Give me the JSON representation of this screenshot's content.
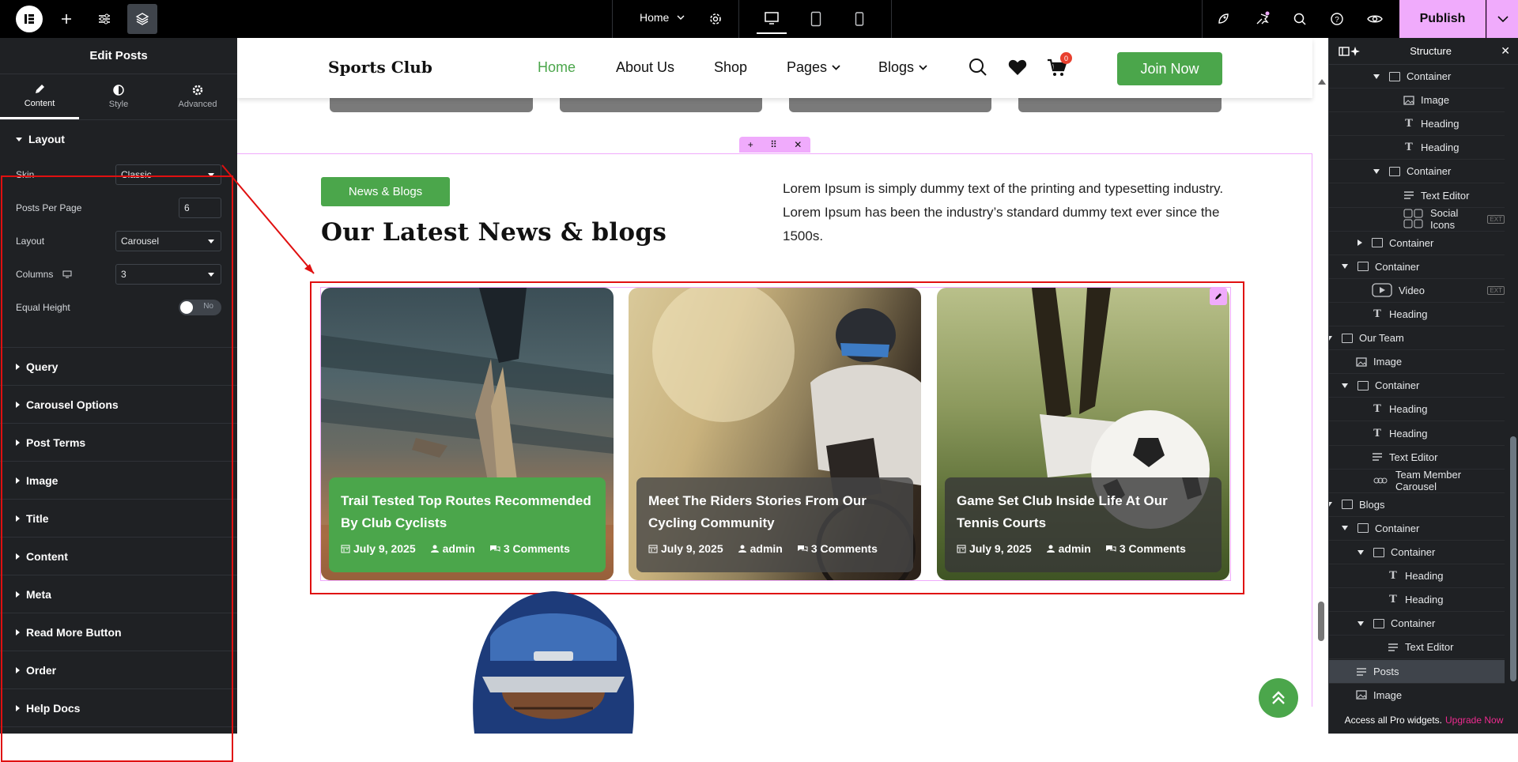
{
  "topbar": {
    "page_name": "Home",
    "publish_label": "Publish"
  },
  "panel": {
    "title": "Edit Posts",
    "tabs": [
      "Content",
      "Style",
      "Advanced"
    ],
    "layout_section": "Layout",
    "controls": {
      "skin_label": "Skin",
      "skin_value": "Classic",
      "ppp_label": "Posts Per Page",
      "ppp_value": "6",
      "layout_label": "Layout",
      "layout_value": "Carousel",
      "columns_label": "Columns",
      "columns_value": "3",
      "equal_label": "Equal Height",
      "equal_value": "No"
    },
    "sections": [
      "Query",
      "Carousel Options",
      "Post Terms",
      "Image",
      "Title",
      "Content",
      "Meta",
      "Read More Button",
      "Order",
      "Help Docs"
    ]
  },
  "site": {
    "brand": "Sports Club",
    "nav": [
      "Home",
      "About Us",
      "Shop",
      "Pages",
      "Blogs"
    ],
    "cart_count": "0",
    "join_label": "Join Now",
    "news_badge": "News & Blogs",
    "news_heading": "Our Latest News & blogs",
    "lorem": "Lorem Ipsum is simply dummy text of the printing and typesetting industry. Lorem Ipsum has been the industry’s standard dummy text ever since the 1500s.",
    "posts": [
      {
        "title": "Trail Tested Top Routes Recommended By Club Cyclists",
        "date": "July 9, 2025",
        "author": "admin",
        "comments": "3 Comments",
        "cover": "#4ba64b"
      },
      {
        "title": "Meet The Riders Stories From Our Cycling Community",
        "date": "July 9, 2025",
        "author": "admin",
        "comments": "3 Comments",
        "cover": "rgba(70,70,70,0.8)"
      },
      {
        "title": "Game Set Club Inside Life At Our Tennis Courts",
        "date": "July 9, 2025",
        "author": "admin",
        "comments": "3 Comments",
        "cover": "rgba(55,55,55,0.8)"
      }
    ]
  },
  "structure": {
    "title": "Structure",
    "nodes": [
      {
        "label": "Container",
        "icon": "container",
        "level": 2,
        "arrow": "down"
      },
      {
        "label": "Image",
        "icon": "image",
        "level": 3
      },
      {
        "label": "Heading",
        "icon": "heading",
        "level": 3
      },
      {
        "label": "Heading",
        "icon": "heading",
        "level": 3
      },
      {
        "label": "Container",
        "icon": "container",
        "level": 2,
        "arrow": "down"
      },
      {
        "label": "Text Editor",
        "icon": "text",
        "level": 3
      },
      {
        "label": "Social Icons",
        "icon": "social",
        "level": 3,
        "ext": true
      },
      {
        "label": "Container",
        "icon": "container",
        "level": 1,
        "arrow": "right"
      },
      {
        "label": "Container",
        "icon": "container",
        "level": 0,
        "arrow": "down"
      },
      {
        "label": "Video",
        "icon": "video",
        "level": 1,
        "ext": true
      },
      {
        "label": "Heading",
        "icon": "heading",
        "level": 1
      },
      {
        "label": "Our Team",
        "icon": "container",
        "level": -1,
        "arrow": "down"
      },
      {
        "label": "Image",
        "icon": "image",
        "level": 0
      },
      {
        "label": "Container",
        "icon": "container",
        "level": 0,
        "arrow": "down"
      },
      {
        "label": "Heading",
        "icon": "heading",
        "level": 1
      },
      {
        "label": "Heading",
        "icon": "heading",
        "level": 1
      },
      {
        "label": "Text Editor",
        "icon": "text",
        "level": 1
      },
      {
        "label": "Team Member Carousel",
        "icon": "carousel",
        "level": 1
      },
      {
        "label": "Blogs",
        "icon": "container",
        "level": -1,
        "arrow": "down"
      },
      {
        "label": "Container",
        "icon": "container",
        "level": 0,
        "arrow": "down"
      },
      {
        "label": "Container",
        "icon": "container",
        "level": 1,
        "arrow": "down"
      },
      {
        "label": "Heading",
        "icon": "heading",
        "level": 2
      },
      {
        "label": "Heading",
        "icon": "heading",
        "level": 2
      },
      {
        "label": "Container",
        "icon": "container",
        "level": 1,
        "arrow": "down"
      },
      {
        "label": "Text Editor",
        "icon": "text",
        "level": 2
      },
      {
        "label": "Posts",
        "icon": "posts",
        "level": 0,
        "selected": true
      },
      {
        "label": "Image",
        "icon": "image",
        "level": 0
      }
    ],
    "footer_text": "Access all Pro widgets.",
    "footer_link": "Upgrade Now",
    "ext_label": "EXT"
  }
}
